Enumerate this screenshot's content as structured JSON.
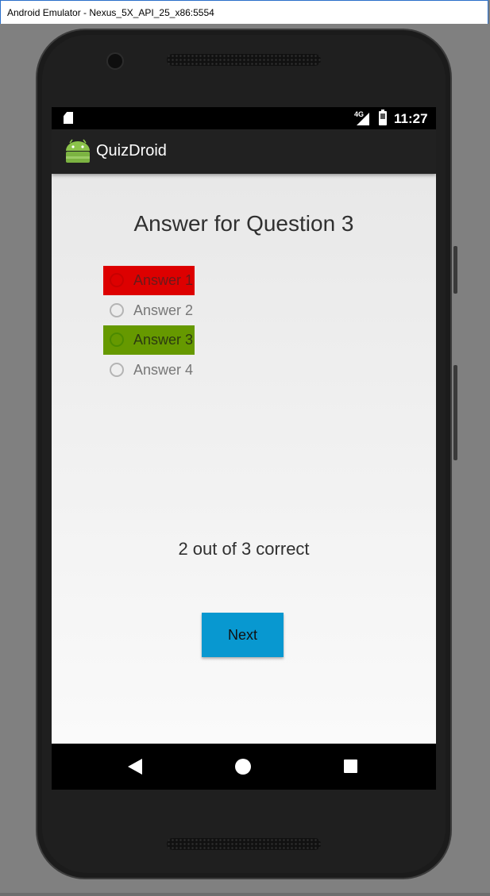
{
  "window": {
    "title": "Android Emulator - Nexus_5X_API_25_x86:5554"
  },
  "status_bar": {
    "network": "4G",
    "time": "11:27"
  },
  "action_bar": {
    "app_name": "QuizDroid",
    "logo_icon": "android-robot-icon"
  },
  "quiz": {
    "heading": "Answer for Question 3",
    "answers": [
      {
        "label": "Answer 1",
        "highlight": "#dd0000",
        "state": "wrong-selected"
      },
      {
        "label": "Answer 2",
        "highlight": "",
        "state": "none"
      },
      {
        "label": "Answer 3",
        "highlight": "#669900",
        "state": "correct"
      },
      {
        "label": "Answer 4",
        "highlight": "",
        "state": "none"
      }
    ],
    "score_text": "2 out of 3 correct",
    "next_label": "Next"
  },
  "nav_bar": {
    "back_icon": "back-triangle-icon",
    "home_icon": "home-circle-icon",
    "recents_icon": "recents-square-icon"
  },
  "colors": {
    "accent_button": "#0898d0",
    "action_bar": "#212121",
    "wrong": "#dd0000",
    "correct": "#669900"
  }
}
